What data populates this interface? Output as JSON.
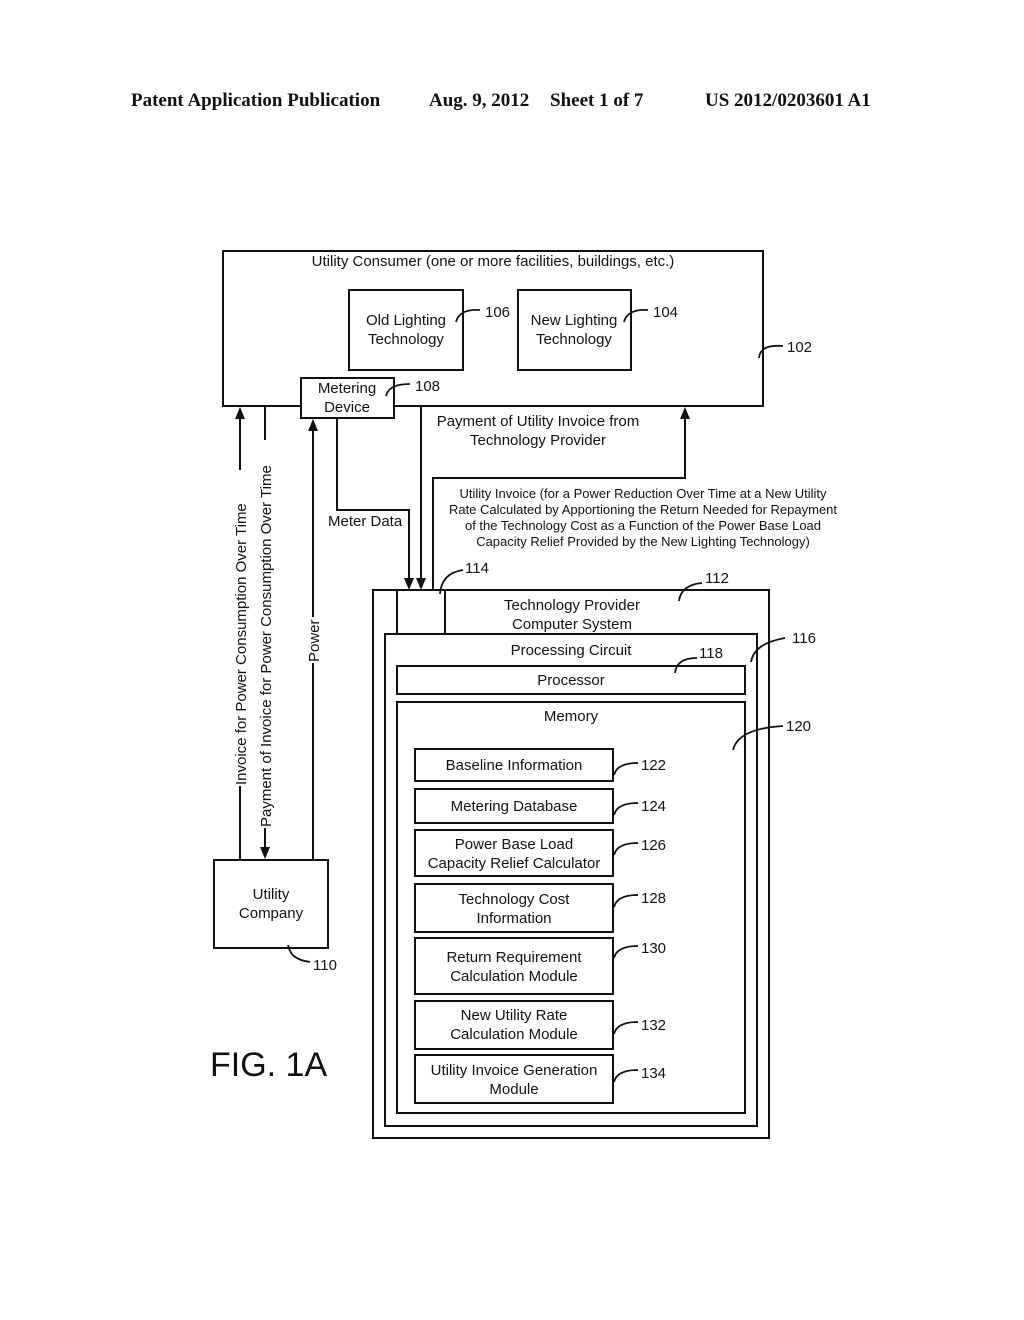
{
  "header": {
    "publication": "Patent Application Publication",
    "date": "Aug. 9, 2012",
    "sheet": "Sheet 1 of 7",
    "number": "US 2012/0203601 A1"
  },
  "consumer": {
    "title": "Utility Consumer (one or more facilities, buildings, etc.)",
    "ref": "102",
    "old_lighting": {
      "line1": "Old Lighting",
      "line2": "Technology",
      "ref": "106"
    },
    "new_lighting": {
      "line1": "New Lighting",
      "line2": "Technology",
      "ref": "104"
    },
    "metering": {
      "line1": "Metering",
      "line2": "Device",
      "ref": "108"
    }
  },
  "flows": {
    "invoice": "Invoice for Power Consumption Over Time",
    "payment": "Payment of Invoice for Power Consumption Over Time",
    "power": "Power",
    "meter_data": "Meter Data",
    "payment_utility": {
      "line1": "Payment of Utility Invoice from",
      "line2": "Technology Provider"
    },
    "utility_invoice": {
      "line1": "Utility Invoice (for a Power Reduction Over Time at a New Utility",
      "line2": "Rate Calculated by Apportioning the Return Needed for Repayment",
      "line3": "of the Technology Cost as a Function of the Power Base Load",
      "line4": "Capacity Relief Provided by the New Lighting Technology)"
    }
  },
  "utility_company": {
    "line1": "Utility",
    "line2": "Company",
    "ref": "110"
  },
  "provider": {
    "line1": "Technology Provider",
    "line2": "Computer System",
    "ref": "112",
    "interface_ref": "114",
    "processing": {
      "title": "Processing Circuit",
      "ref": "116"
    },
    "processor": {
      "title": "Processor",
      "ref": "118"
    },
    "memory": {
      "title": "Memory",
      "ref": "120",
      "modules": [
        {
          "line1": "Baseline Information",
          "line2": "",
          "ref": "122"
        },
        {
          "line1": "Metering Database",
          "line2": "",
          "ref": "124"
        },
        {
          "line1": "Power Base Load",
          "line2": "Capacity Relief Calculator",
          "ref": "126"
        },
        {
          "line1": "Technology Cost",
          "line2": "Information",
          "ref": "128"
        },
        {
          "line1": "Return Requirement",
          "line2": "Calculation Module",
          "ref": "130"
        },
        {
          "line1": "New Utility Rate",
          "line2": "Calculation Module",
          "ref": "132"
        },
        {
          "line1": "Utility Invoice Generation",
          "line2": "Module",
          "ref": "134"
        }
      ]
    }
  },
  "figure_label": "FIG. 1A"
}
